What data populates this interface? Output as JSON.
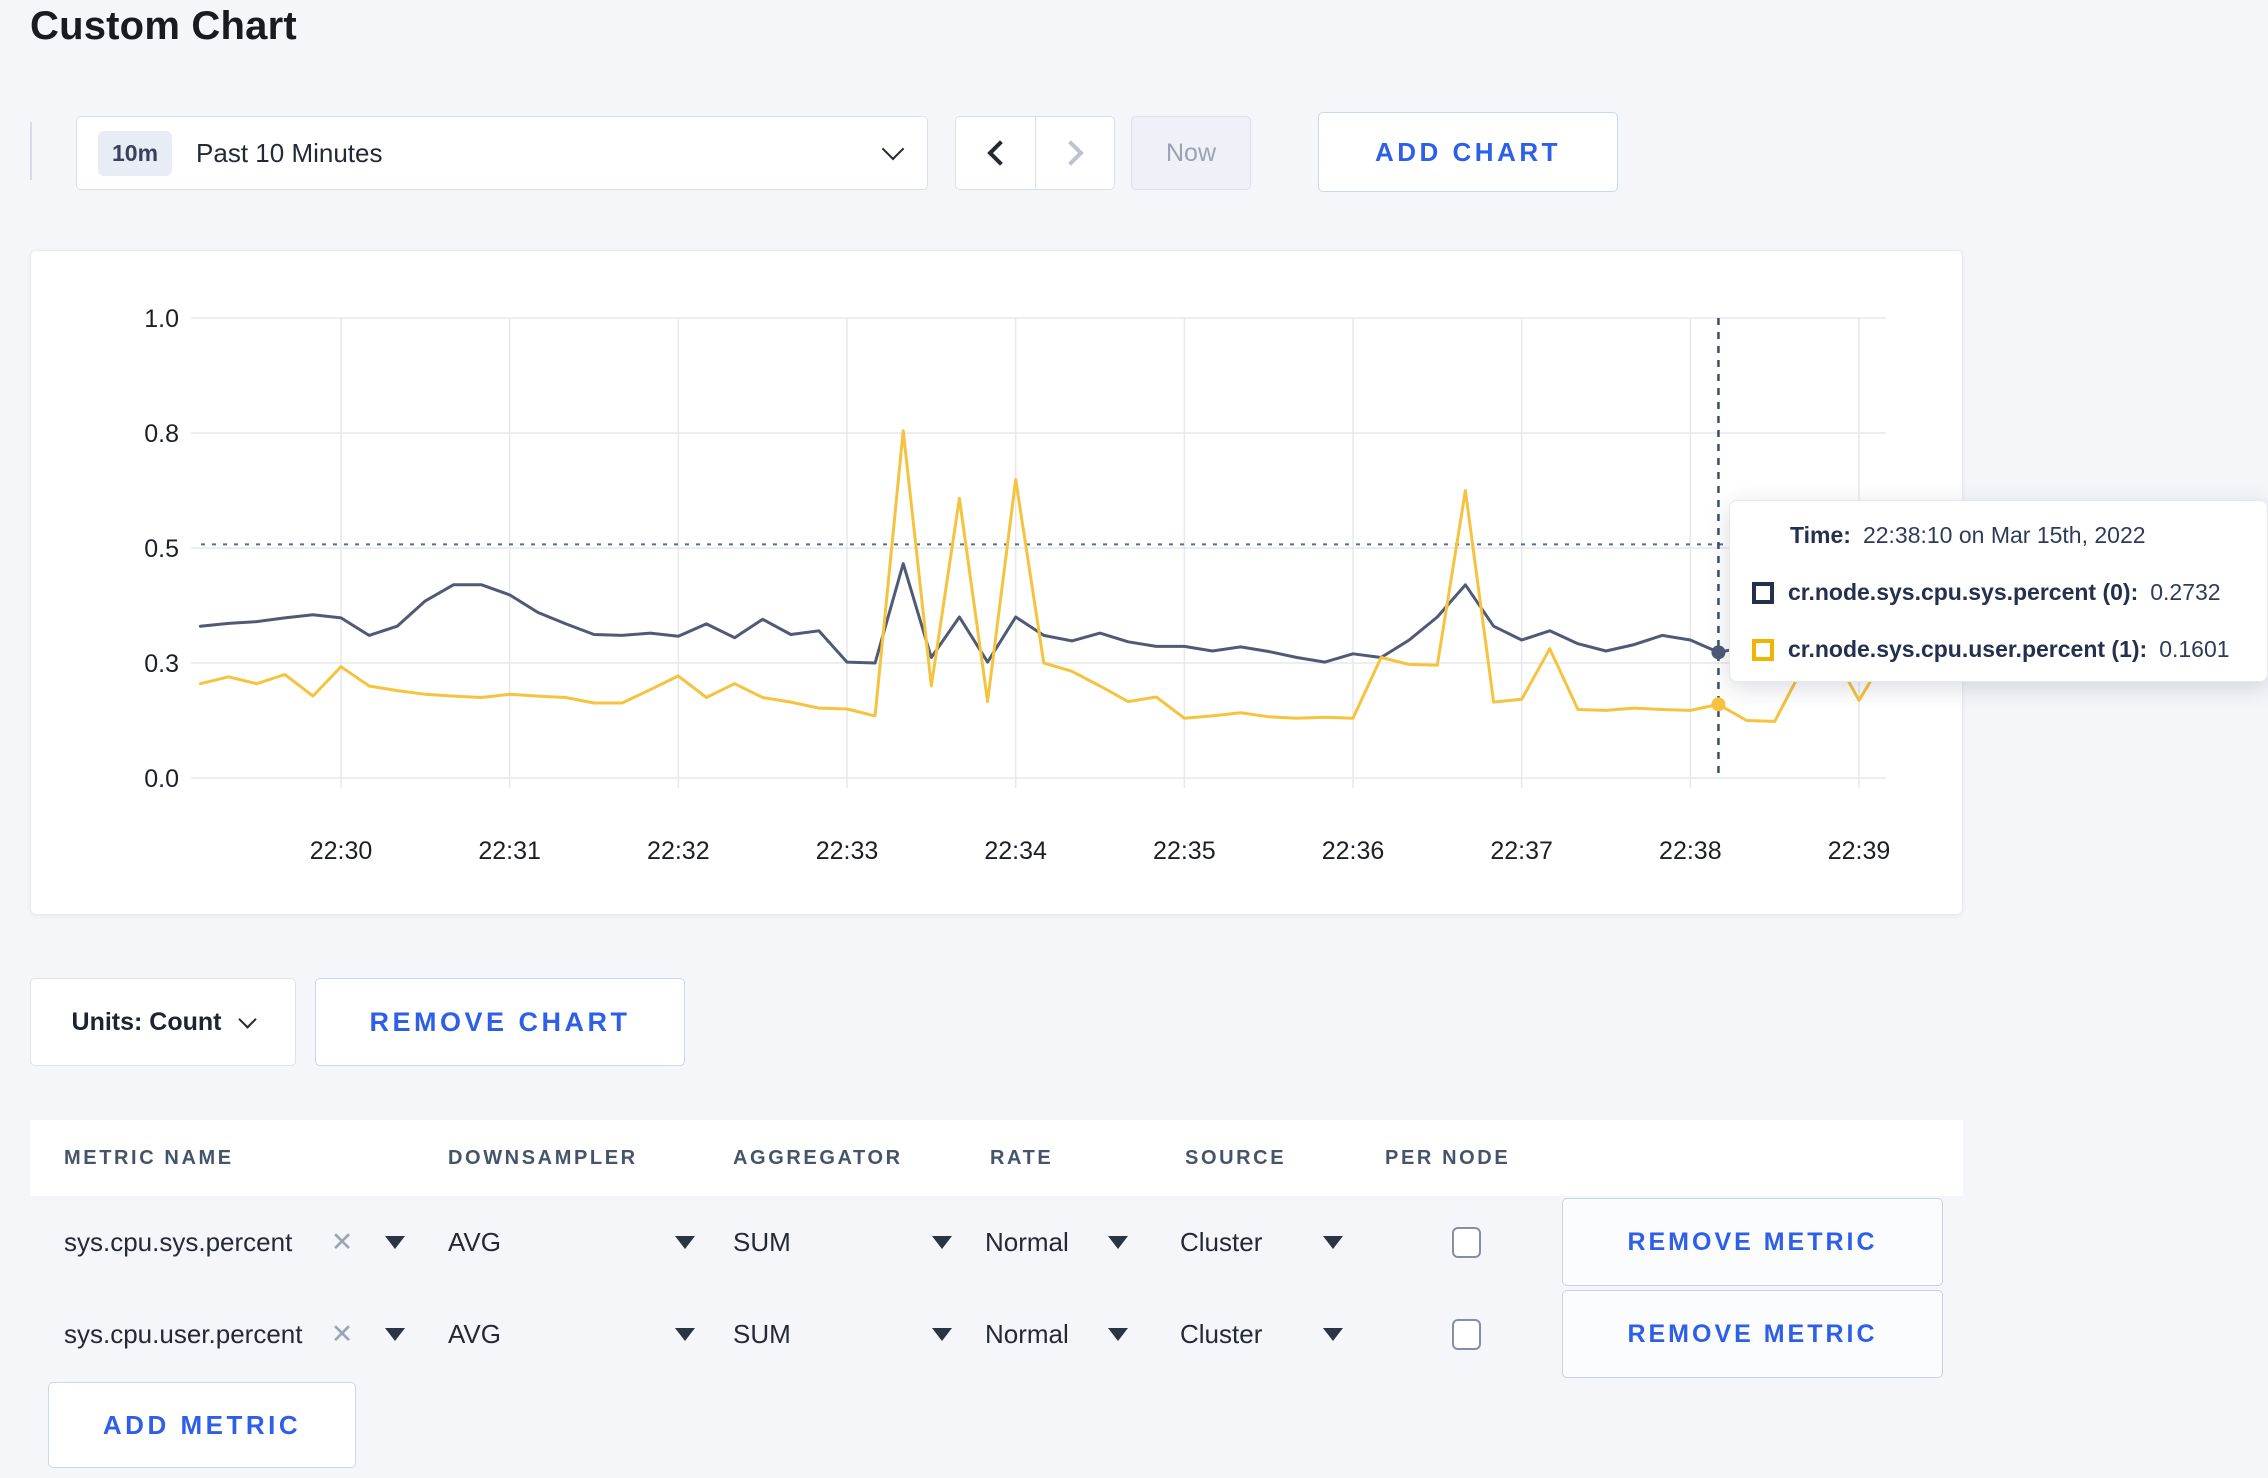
{
  "page": {
    "title": "Custom Chart",
    "background": "#f4f6fa",
    "accent_blue": "#2e5fe8"
  },
  "toolbar": {
    "time_range_badge": "10m",
    "time_range_label": "Past 10 Minutes",
    "now_label": "Now",
    "add_chart_label": "ADD CHART"
  },
  "chart_data": {
    "type": "line",
    "title": "",
    "xlabel": "",
    "ylabel": "",
    "ylim": [
      0,
      1
    ],
    "grid": true,
    "legend_position": "tooltip-overlay",
    "x_ticks": [
      "22:30",
      "22:31",
      "22:32",
      "22:33",
      "22:34",
      "22:35",
      "22:36",
      "22:37",
      "22:38",
      "22:39"
    ],
    "y_tick_labels": [
      "0.0",
      "0.3",
      "0.5",
      "0.8",
      "1.0"
    ],
    "y_tick_values": [
      0,
      0.25,
      0.5,
      0.75,
      1.0
    ],
    "x_start": "22:29:10",
    "x_end": "22:39:10",
    "interval_seconds": 10,
    "series": [
      {
        "name": "cr.node.sys.cpu.sys.percent",
        "color": "#4e5a76",
        "values": [
          0.33,
          0.336,
          0.34,
          0.348,
          0.355,
          0.348,
          0.31,
          0.33,
          0.385,
          0.42,
          0.42,
          0.398,
          0.36,
          0.335,
          0.312,
          0.31,
          0.315,
          0.308,
          0.335,
          0.305,
          0.345,
          0.312,
          0.32,
          0.252,
          0.25,
          0.466,
          0.262,
          0.35,
          0.252,
          0.35,
          0.31,
          0.298,
          0.315,
          0.296,
          0.286,
          0.286,
          0.276,
          0.285,
          0.275,
          0.262,
          0.252,
          0.27,
          0.262,
          0.3,
          0.35,
          0.42,
          0.33,
          0.3,
          0.32,
          0.292,
          0.276,
          0.29,
          0.31,
          0.3,
          0.2732,
          0.285,
          0.3,
          0.305,
          0.3,
          0.298,
          0.302
        ]
      },
      {
        "name": "cr.node.sys.cpu.user.percent",
        "color": "#f5c33e",
        "values": [
          0.205,
          0.22,
          0.205,
          0.225,
          0.178,
          0.242,
          0.2,
          0.19,
          0.182,
          0.178,
          0.175,
          0.182,
          0.178,
          0.175,
          0.163,
          0.163,
          0.192,
          0.222,
          0.175,
          0.205,
          0.175,
          0.165,
          0.152,
          0.15,
          0.135,
          0.755,
          0.2,
          0.608,
          0.166,
          0.649,
          0.25,
          0.232,
          0.2,
          0.166,
          0.176,
          0.13,
          0.135,
          0.142,
          0.133,
          0.13,
          0.132,
          0.13,
          0.262,
          0.247,
          0.245,
          0.625,
          0.165,
          0.171,
          0.281,
          0.149,
          0.147,
          0.152,
          0.149,
          0.147,
          0.1601,
          0.125,
          0.123,
          0.24,
          0.28,
          0.169,
          0.27
        ]
      }
    ],
    "crosshair": {
      "x_index": 54,
      "time": "22:38:10",
      "hline_value": 0.508
    }
  },
  "tooltip": {
    "time_label": "Time:",
    "time_value": "22:38:10 on Mar 15th, 2022",
    "series": [
      {
        "label": "cr.node.sys.cpu.sys.percent (0):",
        "value": "0.2732",
        "color": "#24304e"
      },
      {
        "label": "cr.node.sys.cpu.user.percent (1):",
        "value": "0.1601",
        "color": "#f0b402"
      }
    ]
  },
  "chart_controls": {
    "units_label": "Units: Count",
    "remove_chart_label": "REMOVE CHART"
  },
  "metrics_table": {
    "headers": [
      "METRIC NAME",
      "DOWNSAMPLER",
      "AGGREGATOR",
      "RATE",
      "SOURCE",
      "PER NODE"
    ],
    "rows": [
      {
        "metric_name": "sys.cpu.sys.percent",
        "downsampler": "AVG",
        "aggregator": "SUM",
        "rate": "Normal",
        "source": "Cluster",
        "per_node_checked": false,
        "remove_label": "REMOVE METRIC"
      },
      {
        "metric_name": "sys.cpu.user.percent",
        "downsampler": "AVG",
        "aggregator": "SUM",
        "rate": "Normal",
        "source": "Cluster",
        "per_node_checked": false,
        "remove_label": "REMOVE METRIC"
      }
    ],
    "add_metric_label": "ADD METRIC"
  }
}
